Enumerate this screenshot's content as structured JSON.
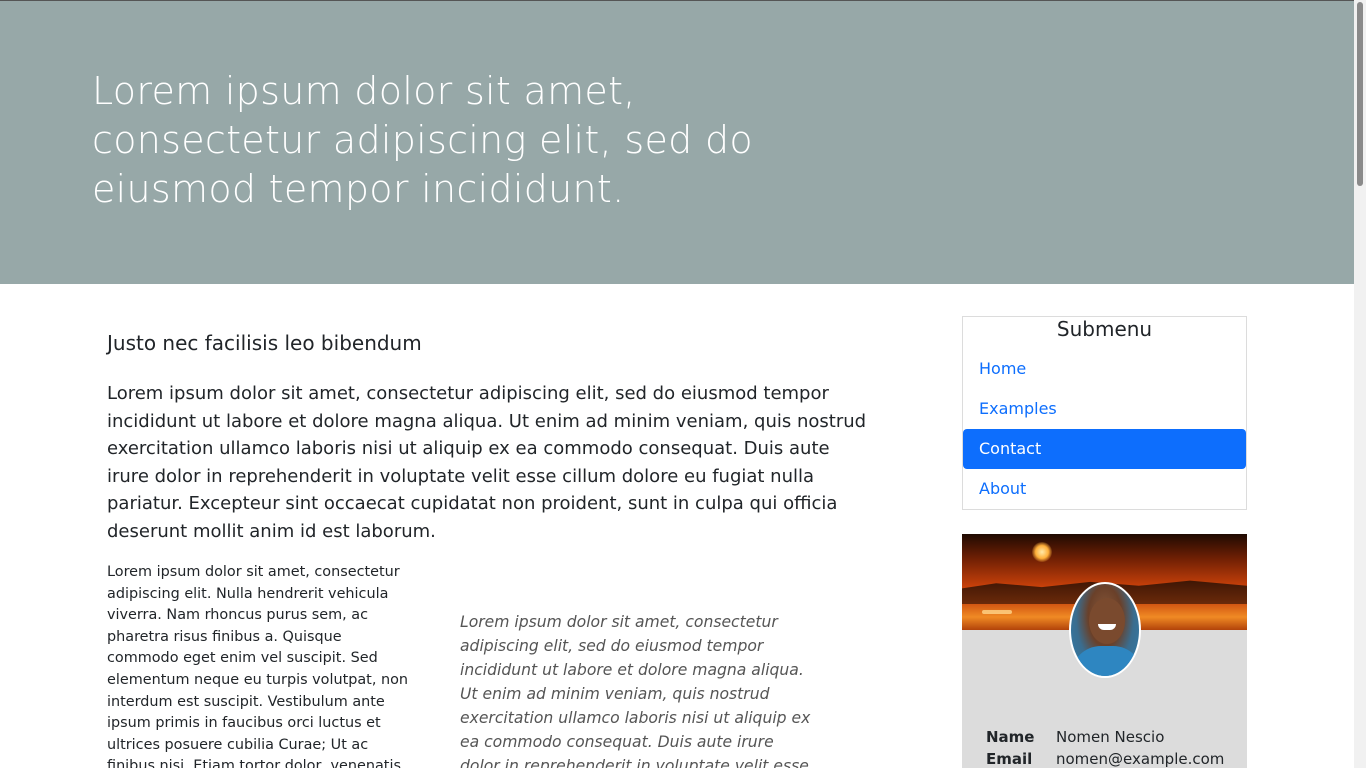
{
  "hero": {
    "title": "Lorem ipsum dolor sit amet, consectetur adipiscing elit, sed do eiusmod tempor incididunt."
  },
  "main": {
    "heading": "Justo nec facilisis leo bibendum",
    "lead": "Lorem ipsum dolor sit amet, consectetur adipiscing elit, sed do eiusmod tempor incididunt ut labore et dolore magna aliqua. Ut enim ad minim veniam, quis nostrud exercitation ullamco laboris nisi ut aliquip ex ea commodo consequat. Duis aute irure dolor in reprehenderit in voluptate velit esse cillum dolore eu fugiat nulla pariatur. Excepteur sint occaecat cupidatat non proident, sunt in culpa qui officia deserunt mollit anim id est laborum.",
    "left_column": "Lorem ipsum dolor sit amet, consectetur adipiscing elit. Nulla hendrerit vehicula viverra. Nam rhoncus purus sem, ac pharetra risus finibus a. Quisque commodo eget enim vel suscipit. Sed elementum neque eu turpis volutpat, non interdum est suscipit. Vestibulum ante ipsum primis in faucibus orci luctus et ultrices posuere cubilia Curae; Ut ac finibus nisi. Etiam tortor dolor, venenatis",
    "right_column": "Lorem ipsum dolor sit amet, consectetur adipiscing elit, sed do eiusmod tempor incididunt ut labore et dolore magna aliqua. Ut enim ad minim veniam, quis nostrud exercitation ullamco laboris nisi ut aliquip ex ea commodo consequat. Duis aute irure dolor in reprehenderit in voluptate velit esse"
  },
  "submenu": {
    "title": "Submenu",
    "items": [
      {
        "label": "Home",
        "active": false
      },
      {
        "label": "Examples",
        "active": false
      },
      {
        "label": "Contact",
        "active": true
      },
      {
        "label": "About",
        "active": false
      }
    ]
  },
  "profile": {
    "name_label": "Name",
    "name_value": "Nomen Nescio",
    "email_label": "Email",
    "email_value": "nomen@example.com"
  },
  "colors": {
    "hero_bg": "#97a8a8",
    "link": "#0d6efd",
    "active_bg": "#0d6efd"
  }
}
